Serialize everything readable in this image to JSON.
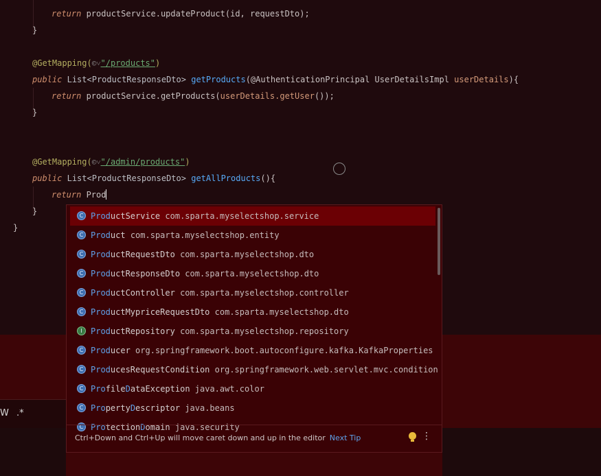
{
  "editor": {
    "lines": {
      "l0_return": "return",
      "l0_rest": " productService.updateProduct(id, requestDto);",
      "brace_close": "}",
      "annotation": "@GetMapping(",
      "globe": "©˅",
      "path_products": "\"/products\"",
      "paren_close": ")",
      "public": "public",
      "list_type": "List<ProductResponseDto>",
      "get_products": "getProducts",
      "auth_param": "(@AuthenticationPrincipal UserDetailsImpl ",
      "user_details": "userDetails",
      "brace_open": "){",
      "return": "return",
      "service_call": " productService.getProducts(",
      "user_details_call": "userDetails.getUser",
      "call_end": "());",
      "path_admin": "\"/admin/products\"",
      "get_all": "getAllProducts",
      "get_all_tail": "(){",
      "typed": " Prod",
      "final_brace": "}"
    }
  },
  "autocomplete": {
    "items": [
      {
        "match": "Prod",
        "rest": "uctService",
        "pkg": "com.sparta.myselectshop.service",
        "icon": "class-icon",
        "selected": true
      },
      {
        "match": "Prod",
        "rest": "uct",
        "pkg": "com.sparta.myselectshop.entity",
        "icon": "class-icon"
      },
      {
        "match": "Prod",
        "rest": "uctRequestDto",
        "pkg": "com.sparta.myselectshop.dto",
        "icon": "class-icon"
      },
      {
        "match": "Prod",
        "rest": "uctResponseDto",
        "pkg": "com.sparta.myselectshop.dto",
        "icon": "class-icon"
      },
      {
        "match": "Prod",
        "rest": "uctController",
        "pkg": "com.sparta.myselectshop.controller",
        "icon": "class-icon"
      },
      {
        "match": "Prod",
        "rest": "uctMypriceRequestDto",
        "pkg": "com.sparta.myselectshop.dto",
        "icon": "class-icon"
      },
      {
        "match": "Prod",
        "rest": "uctRepository",
        "pkg": "com.sparta.myselectshop.repository",
        "icon": "interface-icon"
      },
      {
        "match": "Prod",
        "rest": "ucer",
        "pkg": "org.springframework.boot.autoconfigure.kafka.KafkaProperties",
        "icon": "class-icon"
      },
      {
        "match": "Prod",
        "rest": "ucesRequestCondition",
        "pkg": "org.springframework.web.servlet.mvc.condition",
        "icon": "class-icon"
      },
      {
        "match": "Pro",
        "mid": "f",
        "rest": "ile",
        "match2": "D",
        "rest2": "ataException",
        "pkg": "java.awt.color",
        "icon": "class-icon"
      },
      {
        "match": "Pro",
        "mid": "perty",
        "match2": "D",
        "rest2": "escriptor",
        "pkg": "java.beans",
        "icon": "class-icon"
      },
      {
        "match": "Pro",
        "mid": "tection",
        "match2": "D",
        "rest2": "omain",
        "pkg": "java.security",
        "icon": "class-icon"
      }
    ],
    "footer_tip": "Ctrl+Down and Ctrl+Up will move caret down and up in the editor",
    "next_tip": "Next Tip",
    "more_label": "⋮"
  },
  "find_bar": {
    "words_label": "W",
    "regex_label": ".*"
  }
}
